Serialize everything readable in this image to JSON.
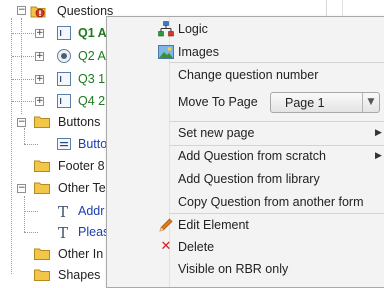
{
  "tree": {
    "root_label": "Questions",
    "questions": [
      {
        "label": "Q1 A"
      },
      {
        "label": "Q2 A"
      },
      {
        "label": "Q3 1"
      },
      {
        "label": "Q4 2"
      }
    ],
    "groups": [
      {
        "label": "Buttons"
      },
      {
        "label": "Footer 8"
      },
      {
        "label": "Other Te"
      },
      {
        "label": "Other In"
      },
      {
        "label": "Shapes"
      }
    ],
    "button_child": "Butto",
    "text_children": [
      {
        "label": "Addr"
      },
      {
        "label": "Pleas"
      }
    ],
    "expander_plus": "+",
    "expander_minus": "−"
  },
  "context_menu": {
    "items": {
      "logic": "Logic",
      "images": "Images",
      "change_number": "Change question number",
      "move_to_page": "Move To Page",
      "move_to_page_value": "Page 1",
      "set_new_page": "Set new page",
      "add_scratch": "Add Question from scratch",
      "add_library": "Add Question from library",
      "copy_other": "Copy Question from another form",
      "edit_element": "Edit Element",
      "delete": "Delete",
      "visible_rbr": "Visible on RBR only"
    },
    "submenu_arrow": "▶",
    "dropdown_arrow": "▼",
    "delete_glyph": "✕",
    "icons": [
      "logic-icon",
      "images-icon",
      "pencil-icon",
      "delete-icon"
    ],
    "colors": {
      "menu_bg": "#f3f3f3",
      "delete": "#d42020",
      "pencil": "#e07a18"
    }
  }
}
